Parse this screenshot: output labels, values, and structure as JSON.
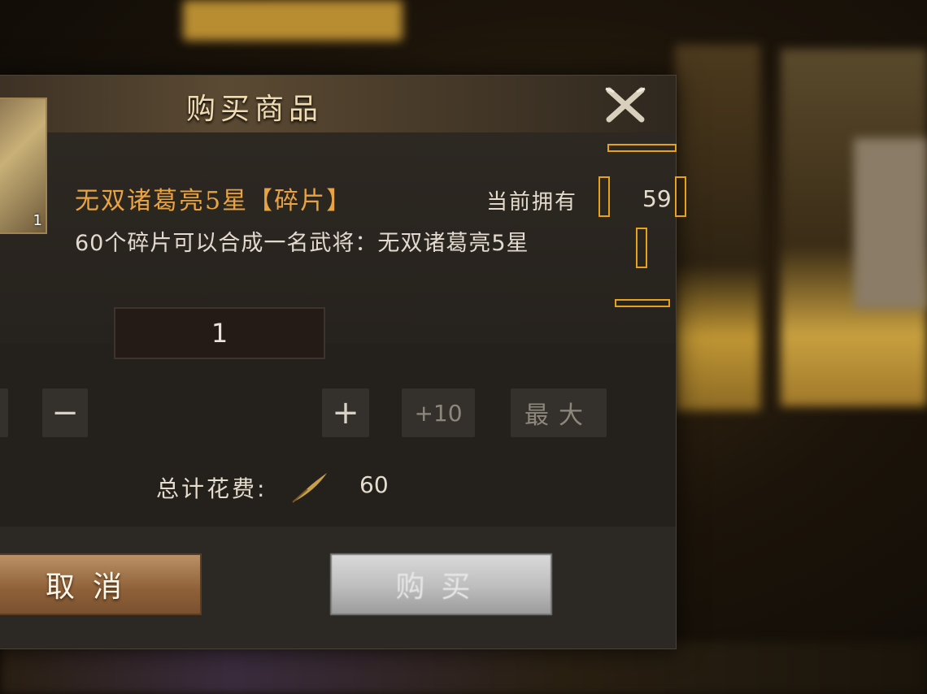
{
  "dialog": {
    "title": "购买商品",
    "close_icon": "close-x-icon"
  },
  "item": {
    "name": "无双诸葛亮5星【碎片】",
    "icon_count": "1",
    "owned_label": "当前拥有",
    "owned_value": "59",
    "description": "60个碎片可以合成一名武将：无双诸葛亮5星"
  },
  "quantity": {
    "minus_label": "−",
    "value": "1",
    "plus_label": "+",
    "plus10_label": "+10",
    "max_label": "最大"
  },
  "total": {
    "label": "总计花费:",
    "currency_icon": "quill-icon",
    "value": "60"
  },
  "buttons": {
    "cancel_label": "取消",
    "buy_label": "购买"
  },
  "colors": {
    "item_name": "#e9a343",
    "marker": "#e8a21a",
    "cancel_button": "#8e6038",
    "buy_button_disabled": "#bdbdbd"
  }
}
